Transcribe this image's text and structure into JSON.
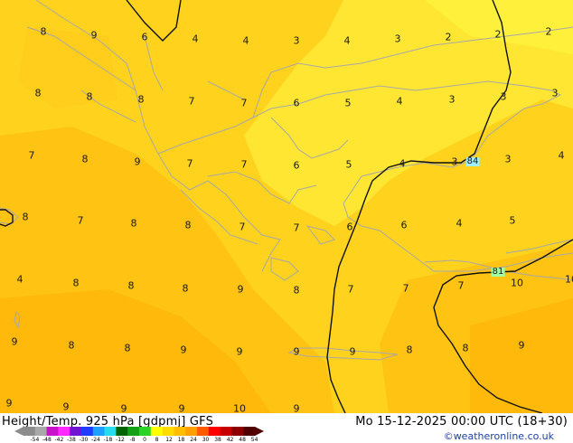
{
  "header": {
    "title": "Height/Temp. 925 hPa [gdpmj] GFS",
    "datetime": "Mo 15-12-2025 00:00 UTC (18+30)",
    "credit": "©weatheronline.co.uk"
  },
  "scale": {
    "ticks": [
      "-54",
      "-48",
      "-42",
      "-38",
      "-30",
      "-24",
      "-18",
      "-12",
      "-8",
      "0",
      "8",
      "12",
      "18",
      "24",
      "30",
      "38",
      "42",
      "48",
      "54"
    ],
    "colors": [
      "#8c8c8c",
      "#a9a9a9",
      "#c814c8",
      "#ff28ff",
      "#6e14d2",
      "#1e3cff",
      "#1ea0ff",
      "#28dcf0",
      "#006400",
      "#14a014",
      "#2bd228",
      "#ffff00",
      "#ffdc00",
      "#ffbe00",
      "#ffa000",
      "#ff5a00",
      "#ff0000",
      "#c80000",
      "#8c0000",
      "#500000"
    ]
  },
  "map": {
    "temp_labels": [
      {
        "text": "8"
      },
      {
        "text": "9"
      },
      {
        "text": "6"
      },
      {
        "text": "4"
      },
      {
        "text": "4"
      },
      {
        "text": "3"
      },
      {
        "text": "4"
      },
      {
        "text": "3"
      },
      {
        "text": "2"
      },
      {
        "text": "2"
      },
      {
        "text": "2"
      },
      {
        "text": "8"
      },
      {
        "text": "8"
      },
      {
        "text": "8"
      },
      {
        "text": "7"
      },
      {
        "text": "7"
      },
      {
        "text": "6"
      },
      {
        "text": "5"
      },
      {
        "text": "4"
      },
      {
        "text": "3"
      },
      {
        "text": "3"
      },
      {
        "text": "3"
      },
      {
        "text": "7"
      },
      {
        "text": "8"
      },
      {
        "text": "9"
      },
      {
        "text": "7"
      },
      {
        "text": "7"
      },
      {
        "text": "6"
      },
      {
        "text": "5"
      },
      {
        "text": "4"
      },
      {
        "text": "3"
      },
      {
        "text": "3"
      },
      {
        "text": "4"
      },
      {
        "text": "8"
      },
      {
        "text": "7"
      },
      {
        "text": "8"
      },
      {
        "text": "8"
      },
      {
        "text": "7"
      },
      {
        "text": "7"
      },
      {
        "text": "6"
      },
      {
        "text": "6"
      },
      {
        "text": "4"
      },
      {
        "text": "5"
      },
      {
        "text": "4"
      },
      {
        "text": "8"
      },
      {
        "text": "8"
      },
      {
        "text": "8"
      },
      {
        "text": "9"
      },
      {
        "text": "8"
      },
      {
        "text": "7"
      },
      {
        "text": "7"
      },
      {
        "text": "7"
      },
      {
        "text": "10"
      },
      {
        "text": "10"
      },
      {
        "text": "9"
      },
      {
        "text": "8"
      },
      {
        "text": "8"
      },
      {
        "text": "9"
      },
      {
        "text": "9"
      },
      {
        "text": "9"
      },
      {
        "text": "9"
      },
      {
        "text": "8"
      },
      {
        "text": "8"
      },
      {
        "text": "9"
      },
      {
        "text": "9"
      },
      {
        "text": "9"
      },
      {
        "text": "9"
      },
      {
        "text": "9"
      },
      {
        "text": "10"
      },
      {
        "text": "9"
      },
      {
        "text": "10"
      }
    ],
    "geopotential_labels": [
      "84",
      "81"
    ]
  }
}
